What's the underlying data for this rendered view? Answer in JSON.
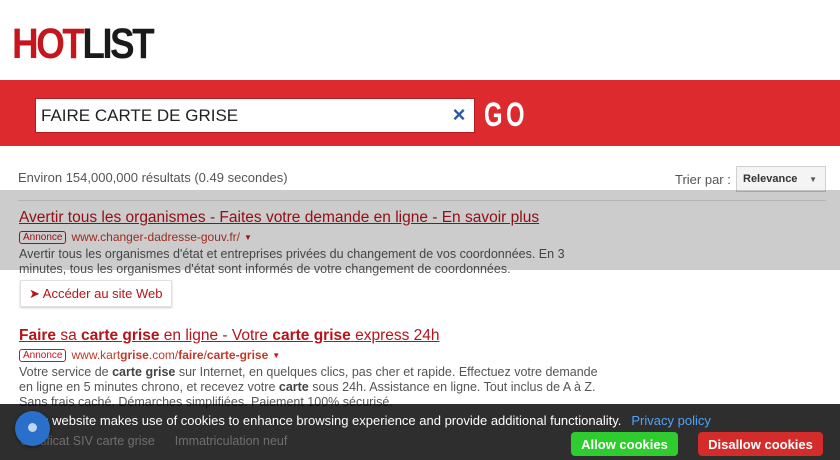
{
  "header": {
    "logo_part1": "HOT",
    "logo_part2": "LIST"
  },
  "search": {
    "query": "FAIRE CARTE DE GRISE",
    "clear_symbol": "×",
    "go_label": "GO"
  },
  "results_header": {
    "count_text": "Environ 154,000,000 résultats (0.49 secondes)",
    "sort_label": "Trier par :",
    "sort_value": "Relevance"
  },
  "ads": [
    {
      "title": "Avertir tous les organismes - Faites votre demande en ligne - En savoir plus",
      "badge": "Annonce",
      "url": "www.changer-dadresse-gouv.fr/",
      "description": "Avertir tous les organismes d'état et entreprises privées du changement de vos coordonnées. En 3 minutes, tous les organismes d'état sont informés de votre changement de coordonnées.",
      "button_label": "➤ Accéder au site Web"
    },
    {
      "title_parts": [
        "Faire",
        " sa ",
        "carte grise",
        " en ligne - Votre ",
        "carte grise",
        " express 24h"
      ],
      "badge": "Annonce",
      "url_parts": [
        "www.kart",
        "grise",
        ".com/",
        "faire",
        "/",
        "carte-grise"
      ],
      "description_parts": [
        "Votre service de ",
        "carte grise",
        " sur Internet, en quelques clics, pas cher et rapide. Effectuez votre demande en ligne en 5 minutes chrono, et recevez votre ",
        "carte",
        " sous 24h. Assistance en ligne. Tout inclus de A à Z. Sans frais caché. Démarches simplifiées. Paiement 100% sécurisé."
      ]
    }
  ],
  "behind_links": [
    "Certificat SIV carte grise",
    "Immatriculation neuf"
  ],
  "cookie": {
    "message": "This website makes use of cookies to enhance browsing experience and provide additional functionality.",
    "privacy_label": "Privacy policy",
    "allow_label": "Allow cookies",
    "disallow_label": "Disallow cookies"
  }
}
